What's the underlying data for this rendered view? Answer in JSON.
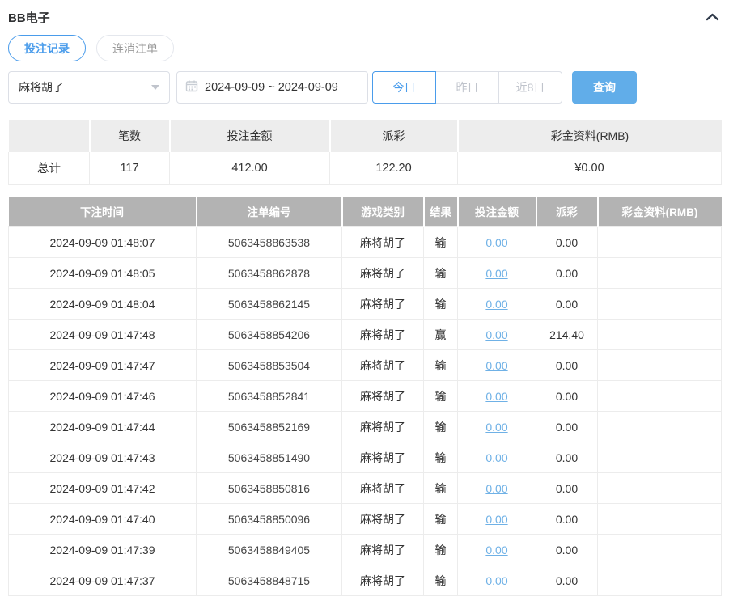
{
  "colors": {
    "accent_blue": "#4a9ceb",
    "query_button_blue": "#61ade9",
    "table_header_gray": "#b3b3b3",
    "summary_header_gray": "#ededed",
    "link_blue": "#6fb1e6"
  },
  "icons": {
    "panel_toggle": "chevron-up-icon",
    "select_caret": "caret-down-icon",
    "date_picker": "calendar-icon"
  },
  "panel": {
    "title": "BB电子"
  },
  "tabs": [
    {
      "label": "投注记录",
      "active": true
    },
    {
      "label": "连消注单",
      "active": false
    }
  ],
  "filters": {
    "game_select": {
      "value": "麻将胡了"
    },
    "date_range": "2024-09-09 ~ 2024-09-09",
    "quick_buttons": [
      {
        "label": "今日",
        "active": true
      },
      {
        "label": "昨日",
        "active": false
      },
      {
        "label": "近8日",
        "active": false
      }
    ],
    "query_label": "查询"
  },
  "summary_table": {
    "headers": [
      "",
      "笔数",
      "投注金额",
      "派彩",
      "彩金资料(RMB)"
    ],
    "row": {
      "label": "总计",
      "count": "117",
      "bet_amount": "412.00",
      "payout": "122.20",
      "jackpot": "¥0.00"
    }
  },
  "records_table": {
    "headers": [
      "下注时间",
      "注单编号",
      "游戏类别",
      "结果",
      "投注金额",
      "派彩",
      "彩金资料(RMB)"
    ],
    "rows": [
      {
        "time": "2024-09-09 01:48:07",
        "order": "5063458863538",
        "game": "麻将胡了",
        "result": "输",
        "bet": "0.00",
        "payout": "0.00",
        "jackpot": ""
      },
      {
        "time": "2024-09-09 01:48:05",
        "order": "5063458862878",
        "game": "麻将胡了",
        "result": "输",
        "bet": "0.00",
        "payout": "0.00",
        "jackpot": ""
      },
      {
        "time": "2024-09-09 01:48:04",
        "order": "5063458862145",
        "game": "麻将胡了",
        "result": "输",
        "bet": "0.00",
        "payout": "0.00",
        "jackpot": ""
      },
      {
        "time": "2024-09-09 01:47:48",
        "order": "5063458854206",
        "game": "麻将胡了",
        "result": "赢",
        "bet": "0.00",
        "payout": "214.40",
        "jackpot": ""
      },
      {
        "time": "2024-09-09 01:47:47",
        "order": "5063458853504",
        "game": "麻将胡了",
        "result": "输",
        "bet": "0.00",
        "payout": "0.00",
        "jackpot": ""
      },
      {
        "time": "2024-09-09 01:47:46",
        "order": "5063458852841",
        "game": "麻将胡了",
        "result": "输",
        "bet": "0.00",
        "payout": "0.00",
        "jackpot": ""
      },
      {
        "time": "2024-09-09 01:47:44",
        "order": "5063458852169",
        "game": "麻将胡了",
        "result": "输",
        "bet": "0.00",
        "payout": "0.00",
        "jackpot": ""
      },
      {
        "time": "2024-09-09 01:47:43",
        "order": "5063458851490",
        "game": "麻将胡了",
        "result": "输",
        "bet": "0.00",
        "payout": "0.00",
        "jackpot": ""
      },
      {
        "time": "2024-09-09 01:47:42",
        "order": "5063458850816",
        "game": "麻将胡了",
        "result": "输",
        "bet": "0.00",
        "payout": "0.00",
        "jackpot": ""
      },
      {
        "time": "2024-09-09 01:47:40",
        "order": "5063458850096",
        "game": "麻将胡了",
        "result": "输",
        "bet": "0.00",
        "payout": "0.00",
        "jackpot": ""
      },
      {
        "time": "2024-09-09 01:47:39",
        "order": "5063458849405",
        "game": "麻将胡了",
        "result": "输",
        "bet": "0.00",
        "payout": "0.00",
        "jackpot": ""
      },
      {
        "time": "2024-09-09 01:47:37",
        "order": "5063458848715",
        "game": "麻将胡了",
        "result": "输",
        "bet": "0.00",
        "payout": "0.00",
        "jackpot": ""
      }
    ]
  }
}
